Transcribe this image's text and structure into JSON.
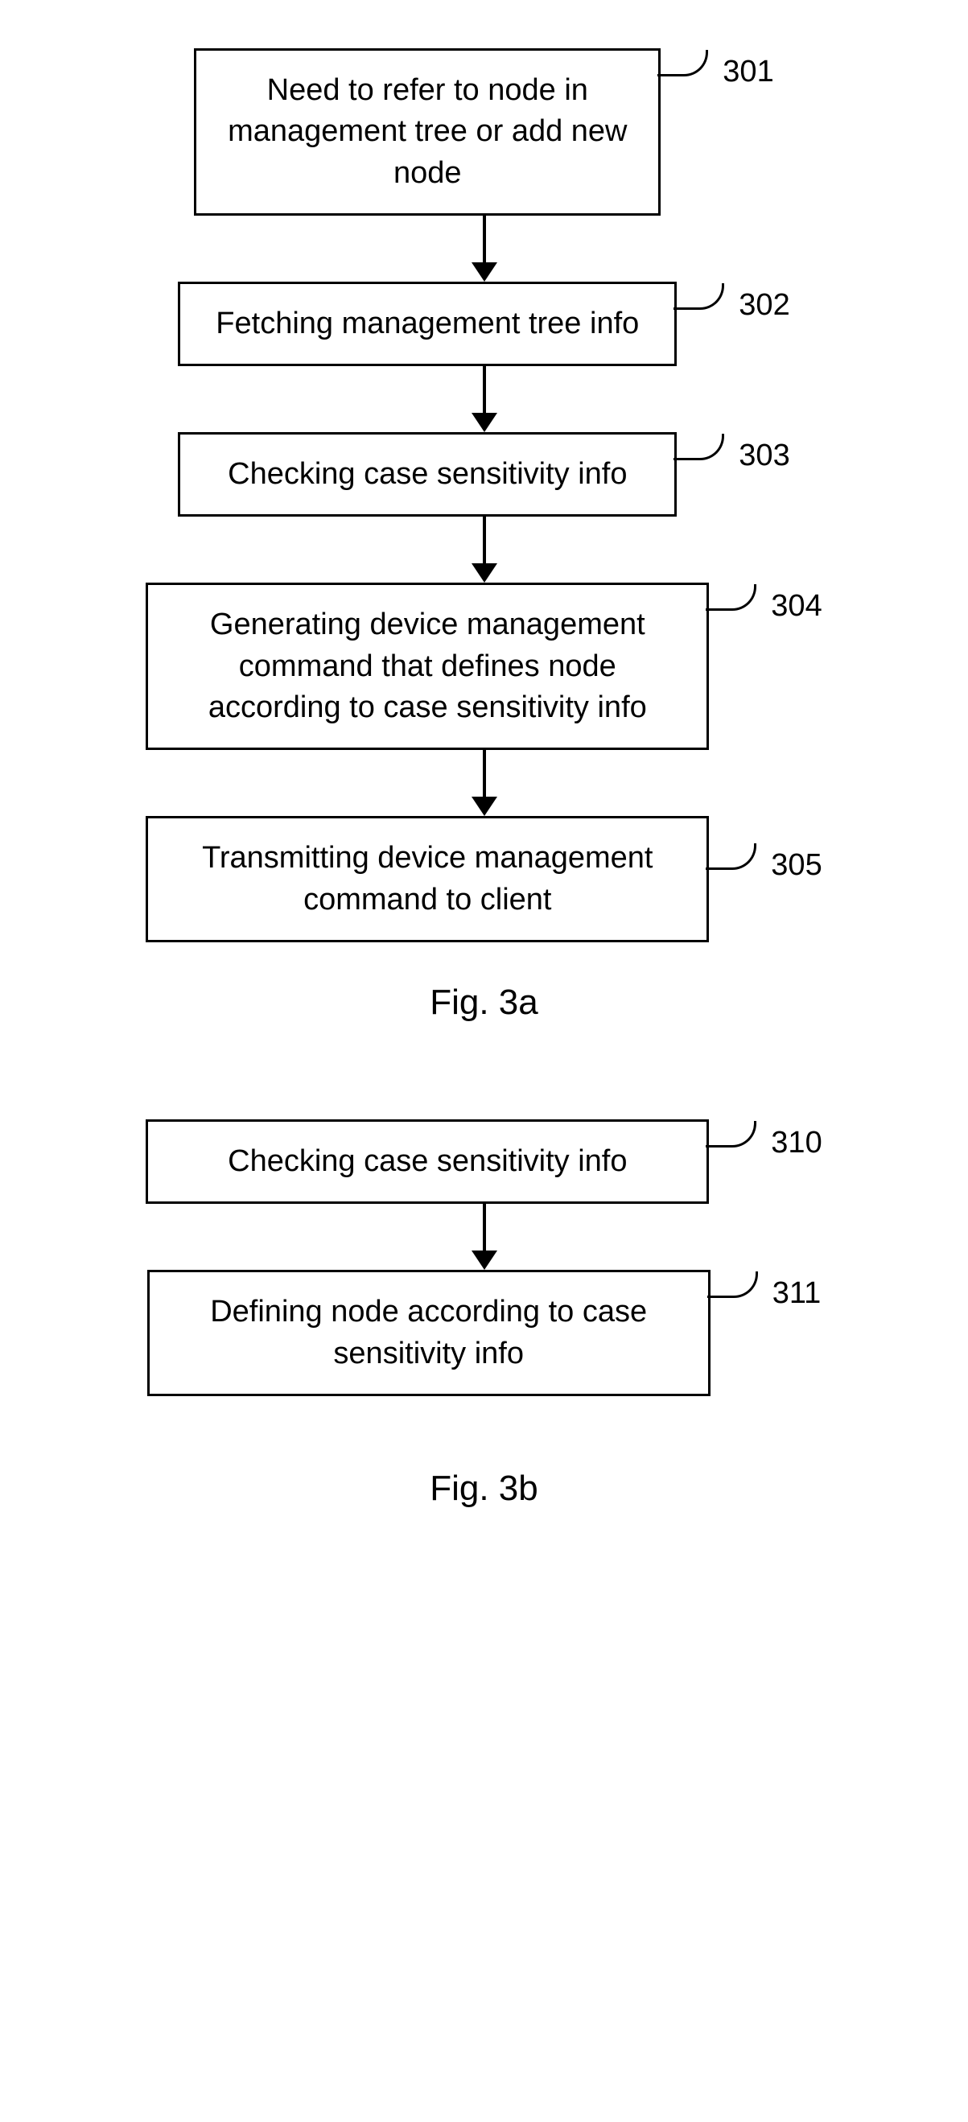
{
  "fig_a": {
    "caption": "Fig. 3a",
    "steps": [
      {
        "num": "301",
        "text": "Need to refer to node in management tree or add new node"
      },
      {
        "num": "302",
        "text": "Fetching management tree info"
      },
      {
        "num": "303",
        "text": "Checking case sensitivity info"
      },
      {
        "num": "304",
        "text": "Generating device management command that defines node according to case sensitivity info"
      },
      {
        "num": "305",
        "text": "Transmitting device management command to client"
      }
    ]
  },
  "fig_b": {
    "caption": "Fig. 3b",
    "steps": [
      {
        "num": "310",
        "text": "Checking case sensitivity info"
      },
      {
        "num": "311",
        "text": "Defining node according to case sensitivity info"
      }
    ]
  }
}
